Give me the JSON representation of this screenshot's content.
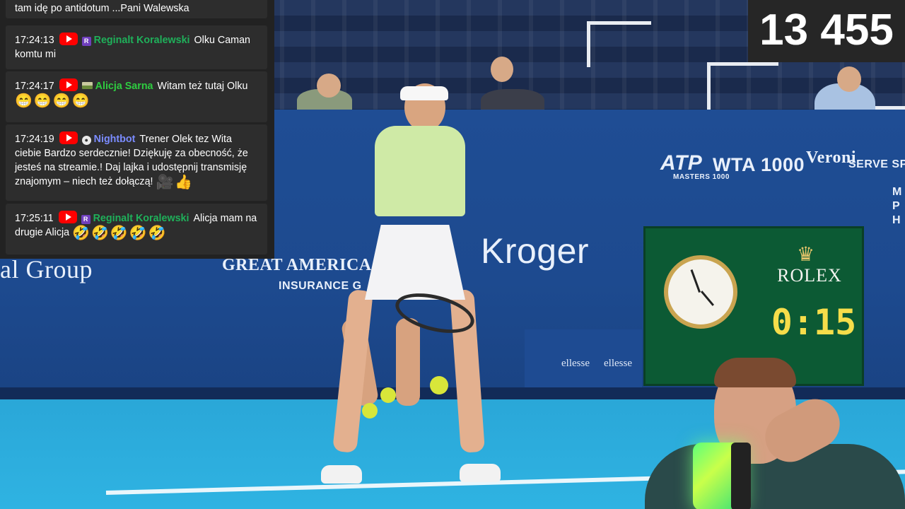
{
  "stream": {
    "viewer_count": "13 455"
  },
  "chat": {
    "partial_first_line": "tam idę po antidotum ...Pani Walewska",
    "messages": [
      {
        "time": "17:24:13",
        "badge": "R",
        "user": "Reginalt Koralewski",
        "user_color": "#1fb05a",
        "text": "Olku Caman komtu mi",
        "emoji": ""
      },
      {
        "time": "17:24:17",
        "badge": "",
        "user": "Alicja Sarna",
        "user_color": "#2ecc40",
        "text": "Witam też tutaj Olku",
        "emoji": "😁😁😁😁"
      },
      {
        "time": "17:24:19",
        "badge": "",
        "user": "Nightbot",
        "user_color": "#7b8cff",
        "text": "Trener Olek tez Wita ciebie Bardzo serdecznie! Dziękuję za obecność, że jesteś na streamie.! Daj lajka i udostępnij transmisję znajomym – niech też dołączą!",
        "emoji": "🎥👍"
      },
      {
        "time": "17:25:11",
        "badge": "R",
        "user": "Reginalt Koralewski",
        "user_color": "#1fb05a",
        "text": "Alicja mam na drugie Alicja",
        "emoji": "🤣🤣🤣🤣🤣"
      }
    ]
  },
  "scene": {
    "sponsors": {
      "atp": "ATP",
      "atp_sub": "MASTERS 1000",
      "wta": "WTA 1000",
      "veroni": "Veroni",
      "serve_speed": "SERVE SPEED",
      "mph": "M P H",
      "kroger": "Kroger",
      "great_american": "GREAT AMERICA",
      "insurance": "INSURANCE G",
      "group": "al Group",
      "ellesse_1": "ellesse",
      "ellesse_2": "ellesse"
    },
    "scoreboard": {
      "brand": "ROLEX",
      "shot_clock": "0:15"
    }
  },
  "colors": {
    "chat_bg": "#222222",
    "message_bg": "#2d2d2d",
    "youtube_red": "#ff0000",
    "wall_blue": "#1f4d94",
    "court_blue": "#2fb3e2",
    "rolex_green": "#0c5a34",
    "clock_yellow": "#f6dd4a"
  }
}
